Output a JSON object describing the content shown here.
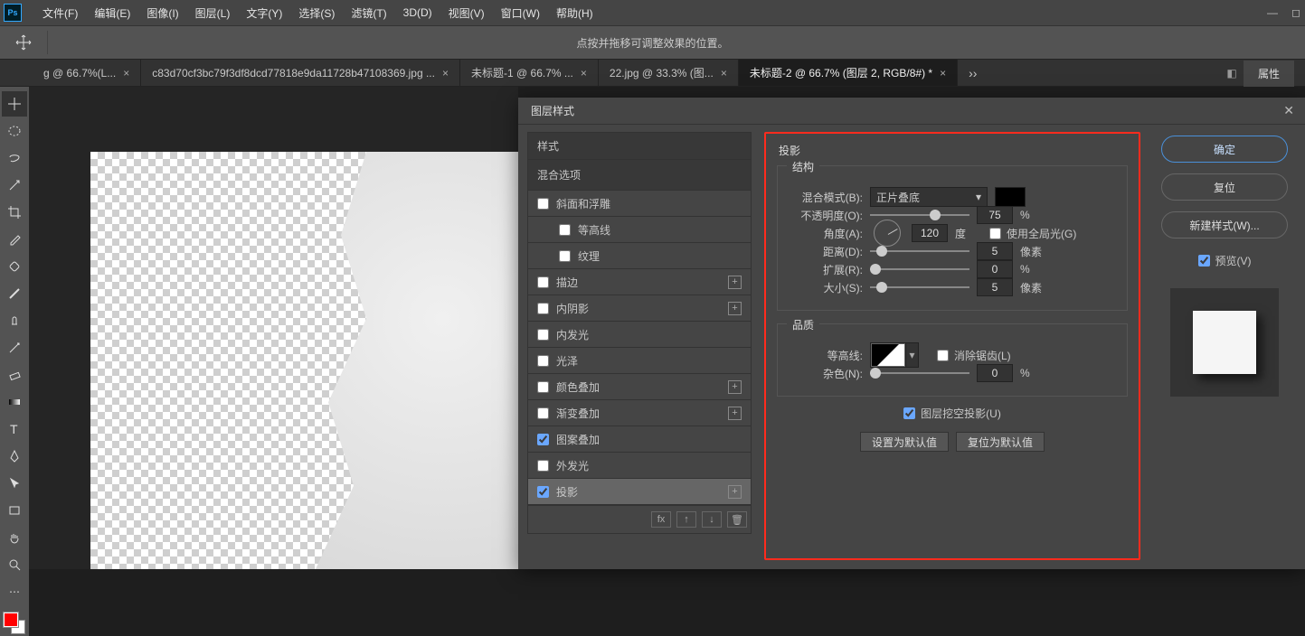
{
  "menu": {
    "items": [
      "文件(F)",
      "编辑(E)",
      "图像(I)",
      "图层(L)",
      "文字(Y)",
      "选择(S)",
      "滤镜(T)",
      "3D(D)",
      "视图(V)",
      "窗口(W)",
      "帮助(H)"
    ]
  },
  "options_bar": {
    "hint": "点按并拖移可调整效果的位置。"
  },
  "tabs": {
    "items": [
      {
        "label": "g @ 66.7%(L...",
        "close": "×"
      },
      {
        "label": "c83d70cf3bc79f3df8dcd77818e9da11728b47108369.jpg ...",
        "close": "×"
      },
      {
        "label": "未标题-1 @ 66.7% ...",
        "close": "×"
      },
      {
        "label": "22.jpg @ 33.3% (图...",
        "close": "×"
      },
      {
        "label": "未标题-2 @ 66.7% (图层 2, RGB/8#) *",
        "close": "×",
        "active": true
      }
    ],
    "more": "››"
  },
  "panel_tab": "属性",
  "tools": [
    "move",
    "marquee",
    "lasso",
    "wand",
    "crop",
    "eyedropper",
    "heal",
    "brush",
    "stamp",
    "history",
    "eraser",
    "gradient",
    "type",
    "pen",
    "arrow",
    "rect",
    "hand",
    "zoom",
    "dots"
  ],
  "dialog": {
    "title": "图层样式",
    "styles_header": "样式",
    "blend_options": "混合选项",
    "list": [
      {
        "k": "bevel",
        "label": "斜面和浮雕",
        "checked": false,
        "plus": false
      },
      {
        "k": "contour",
        "label": "等高线",
        "indent": true,
        "checked": false,
        "plus": false
      },
      {
        "k": "texture",
        "label": "纹理",
        "indent": true,
        "checked": false,
        "plus": false
      },
      {
        "k": "stroke",
        "label": "描边",
        "checked": false,
        "plus": true
      },
      {
        "k": "innerShadow",
        "label": "内阴影",
        "checked": false,
        "plus": true
      },
      {
        "k": "innerGlow",
        "label": "内发光",
        "checked": false,
        "plus": false
      },
      {
        "k": "satin",
        "label": "光泽",
        "checked": false,
        "plus": false
      },
      {
        "k": "colorOverlay",
        "label": "颜色叠加",
        "checked": false,
        "plus": true
      },
      {
        "k": "gradOverlay",
        "label": "渐变叠加",
        "checked": false,
        "plus": true
      },
      {
        "k": "patOverlay",
        "label": "图案叠加",
        "checked": true,
        "plus": false
      },
      {
        "k": "outerGlow",
        "label": "外发光",
        "checked": false,
        "plus": false
      },
      {
        "k": "dropShadow",
        "label": "投影",
        "checked": true,
        "plus": true,
        "selected": true
      }
    ],
    "settings": {
      "title": "投影",
      "structure": {
        "title": "结构",
        "blend_mode": {
          "label": "混合模式(B):",
          "value": "正片叠底"
        },
        "color": "#000000",
        "opacity": {
          "label": "不透明度(O):",
          "value": "75",
          "unit": "%",
          "thumb": 60
        },
        "angle": {
          "label": "角度(A):",
          "value": "120",
          "unit": "度"
        },
        "global": {
          "label": "使用全局光(G)",
          "checked": false
        },
        "distance": {
          "label": "距离(D):",
          "value": "5",
          "unit": "像素",
          "thumb": 6
        },
        "spread": {
          "label": "扩展(R):",
          "value": "0",
          "unit": "%",
          "thumb": 0
        },
        "size": {
          "label": "大小(S):",
          "value": "5",
          "unit": "像素",
          "thumb": 6
        }
      },
      "quality": {
        "title": "品质",
        "contour": {
          "label": "等高线:"
        },
        "anti_alias": {
          "label": "消除锯齿(L)",
          "checked": false
        },
        "noise": {
          "label": "杂色(N):",
          "value": "0",
          "unit": "%",
          "thumb": 0
        }
      },
      "knockout": {
        "label": "图层挖空投影(U)",
        "checked": true
      },
      "defaults": {
        "set": "设置为默认值",
        "reset": "复位为默认值"
      }
    },
    "actions": {
      "ok": "确定",
      "reset": "复位",
      "newStyle": "新建样式(W)...",
      "preview": "预览(V)",
      "preview_checked": true
    }
  }
}
